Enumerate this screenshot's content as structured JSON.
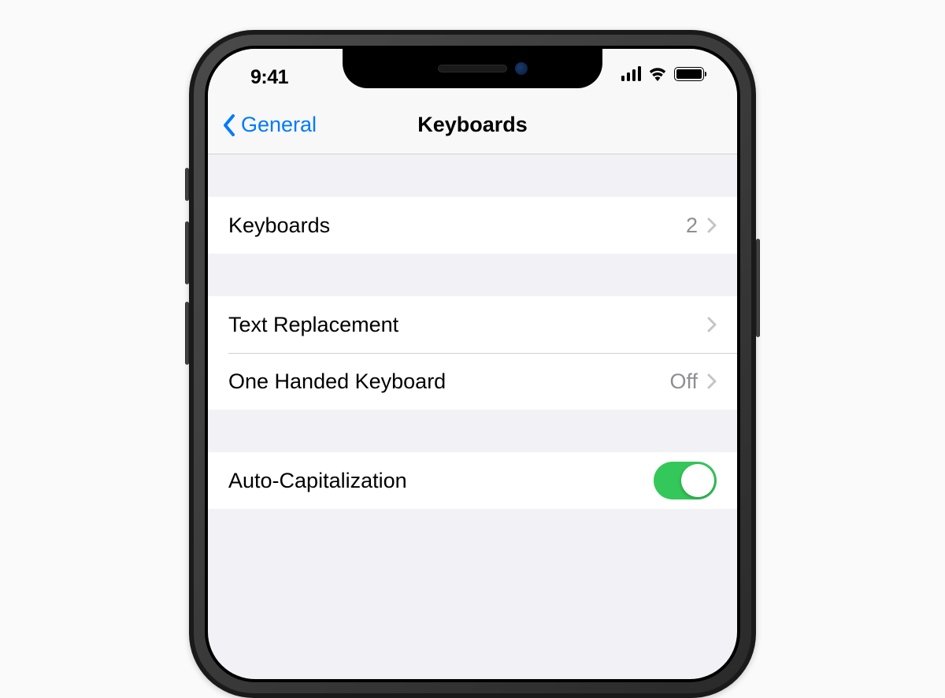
{
  "status": {
    "time": "9:41"
  },
  "nav": {
    "back_label": "General",
    "title": "Keyboards"
  },
  "sections": [
    {
      "rows": [
        {
          "label": "Keyboards",
          "value": "2",
          "disclosure": true
        }
      ]
    },
    {
      "rows": [
        {
          "label": "Text Replacement",
          "value": "",
          "disclosure": true
        },
        {
          "label": "One Handed Keyboard",
          "value": "Off",
          "disclosure": true
        }
      ]
    },
    {
      "rows": [
        {
          "label": "Auto-Capitalization",
          "toggle": true,
          "toggle_on": true
        }
      ]
    }
  ]
}
